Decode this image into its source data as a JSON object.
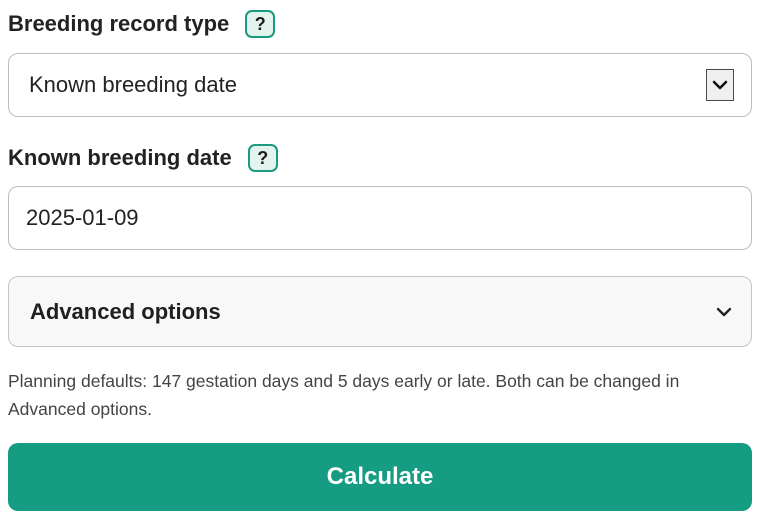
{
  "breeding_record_type": {
    "label": "Breeding record type",
    "help": "?",
    "selected": "Known breeding date"
  },
  "known_breeding_date": {
    "label": "Known breeding date",
    "help": "?",
    "value": "2025-01-09"
  },
  "advanced_options": {
    "title": "Advanced options"
  },
  "note": {
    "text": "Planning defaults: 147 gestation days and 5 days early or late. Both can be changed in Advanced options."
  },
  "calculate": {
    "label": "Calculate"
  },
  "colors": {
    "accent": "#169c82",
    "help_border": "#1a9a7f",
    "help_bg": "#e3f4ef"
  },
  "icons": {
    "select_arrow": "chevron-down-icon",
    "advanced_toggle": "chevron-down-icon"
  }
}
